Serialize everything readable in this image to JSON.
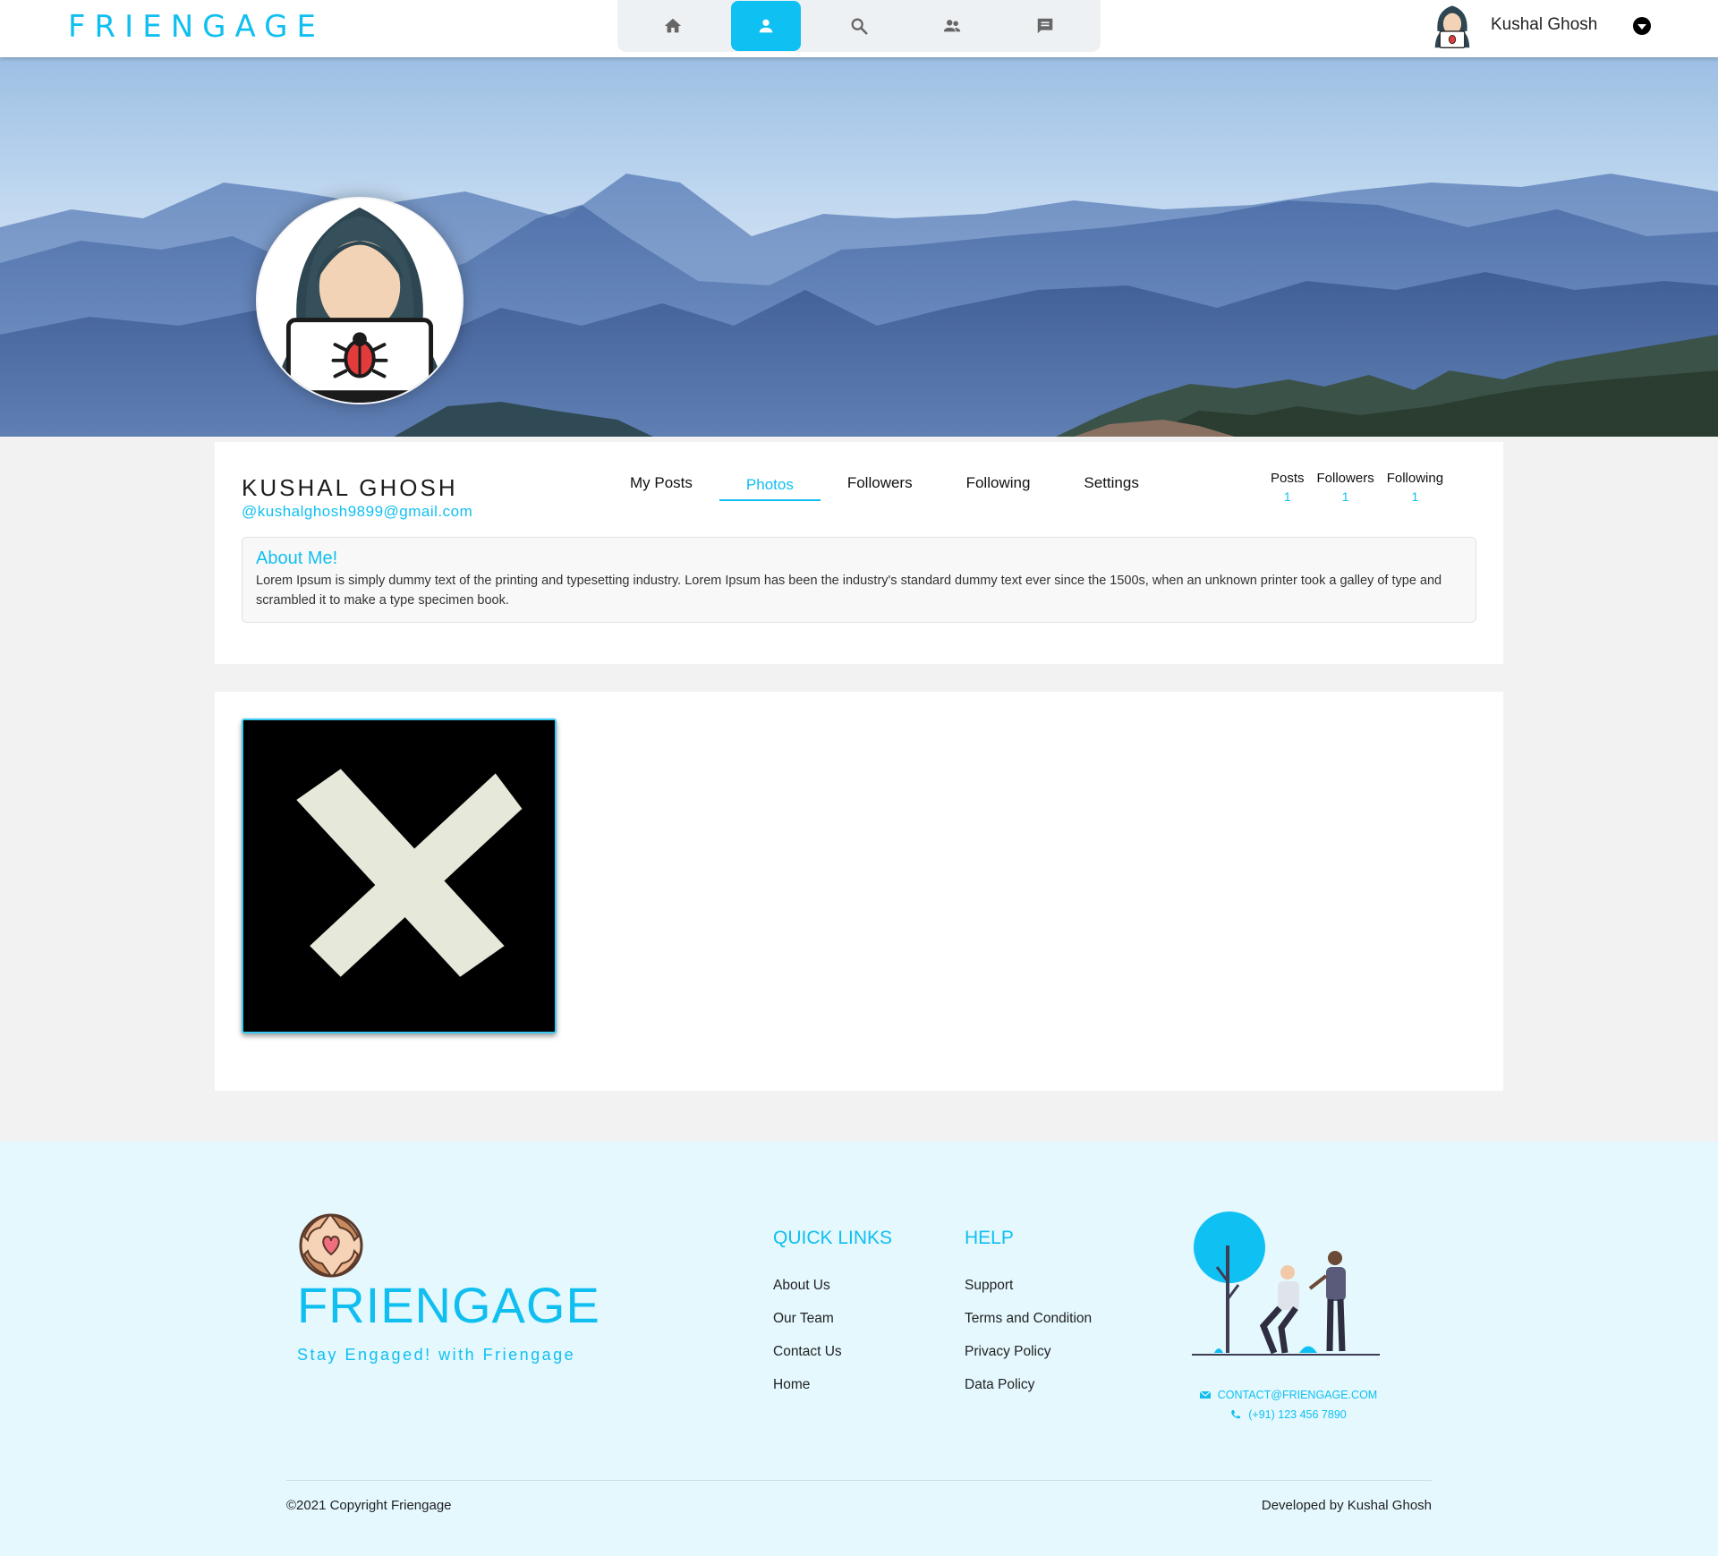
{
  "brand": "FRIENGAGE",
  "nav": {
    "items": [
      {
        "icon": "home-icon"
      },
      {
        "icon": "profile-icon",
        "active": true
      },
      {
        "icon": "search-icon"
      },
      {
        "icon": "friends-icon"
      },
      {
        "icon": "messages-icon"
      }
    ]
  },
  "user": {
    "name": "Kushal Ghosh"
  },
  "profile": {
    "name": "KUSHAL GHOSH",
    "email": "@kushalghosh9899@gmail.com",
    "tabs": [
      "My Posts",
      "Photos",
      "Followers",
      "Following",
      "Settings"
    ],
    "active_tab": "Photos",
    "stats": [
      {
        "label": "Posts",
        "value": "1"
      },
      {
        "label": "Followers",
        "value": "1"
      },
      {
        "label": "Following",
        "value": "1"
      }
    ],
    "about_title": "About Me!",
    "about_text": "Lorem Ipsum is simply dummy text of the printing and typesetting industry. Lorem Ipsum has been the industry's standard dummy text ever since the 1500s, when an unknown printer took a galley of type and scrambled it to make a type specimen book."
  },
  "footer": {
    "brand": "FRIENGAGE",
    "tagline": "Stay Engaged! with Friengage",
    "quick_links_title": "QUICK LINKS",
    "quick_links": [
      "About Us",
      "Our Team",
      "Contact Us",
      "Home"
    ],
    "help_title": "HELP",
    "help_links": [
      "Support",
      "Terms and Condition",
      "Privacy Policy",
      "Data Policy"
    ],
    "email": "CONTACT@FRIENGAGE.COM",
    "phone": "(+91) 123 456 7890",
    "copyright": "©2021 Copyright Friengage",
    "developer": "Developed by Kushal Ghosh"
  },
  "colors": {
    "accent": "#10bff0",
    "footer_bg": "#e4f8fe"
  }
}
